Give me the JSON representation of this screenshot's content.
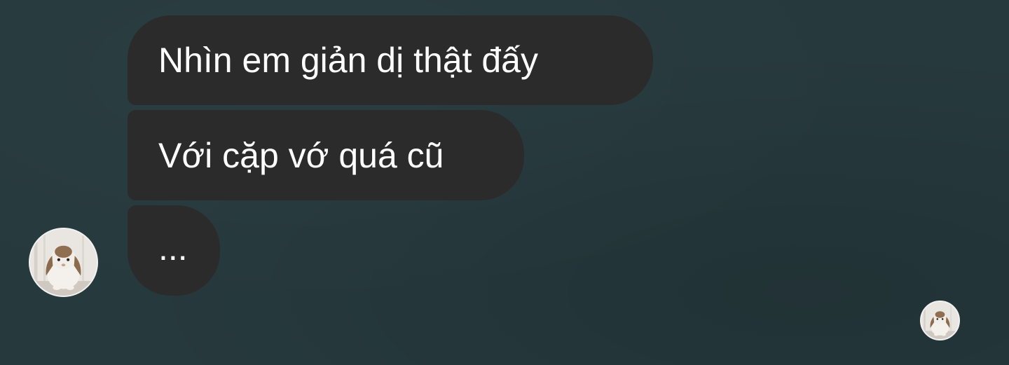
{
  "conversation": {
    "messages": [
      {
        "text": "Nhìn em giản dị thật đấy"
      },
      {
        "text": "Với cặp vớ quá cũ"
      },
      {
        "text": "..."
      }
    ],
    "sender_avatar": {
      "icon": "bunny-avatar-icon"
    },
    "read_receipt_avatar": {
      "icon": "bunny-avatar-icon"
    }
  },
  "colors": {
    "background": "#26393d",
    "bubble": "#2b2b2b",
    "text": "#ffffff"
  }
}
